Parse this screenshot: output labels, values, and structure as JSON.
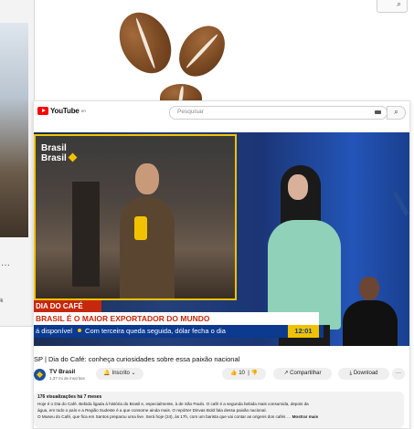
{
  "background_window": {
    "search_icon": "search-icon",
    "menu_dots": "···",
    "snippet": "ok"
  },
  "youtube": {
    "logo_text": "YouTube",
    "logo_region": "BR",
    "search_placeholder": "Pesquisar",
    "search_icon": "search-icon"
  },
  "video": {
    "brand": "Brasil",
    "brand_line2": "Brasil",
    "lower_third": {
      "tag": "DIA DO CAFÉ",
      "headline": "BRASIL É O MAIOR EXPORTADOR DO MUNDO",
      "ticker_prefix": "á disponível",
      "ticker_text": "Com terceira queda seguida, dólar fecha o dia",
      "time": "12:01"
    }
  },
  "meta": {
    "title": "SP | Dia do Café: conheça curiosidades sobre essa paixão nacional",
    "channel": {
      "name": "TV Brasil",
      "subs": "1,37 mi de inscritos"
    },
    "subscribe_label": "Inscrito",
    "like_count": "10",
    "share_label": "Compartilhar",
    "download_label": "Download",
    "more_label": "···"
  },
  "description": {
    "stats": "176 visualizações  há 7 meses",
    "line1": "Hoje é o Dia do Café. Bebida ligada à história do Brasil e, especialmente, à de São Paulo. O café é a segunda bebida mais consumida, depois da",
    "line2": "água, em todo o país e a Região Sudeste é a que consome ainda mais. O repórter Dinvas Bold fala dessa paixão nacional.",
    "line3": "O Museu do Café, que fica em Santos preparou uma live. Será hoje (24), às 17h, com um barista que vai contar as origens dos cafés …",
    "show_more": "Mostrar mais"
  }
}
